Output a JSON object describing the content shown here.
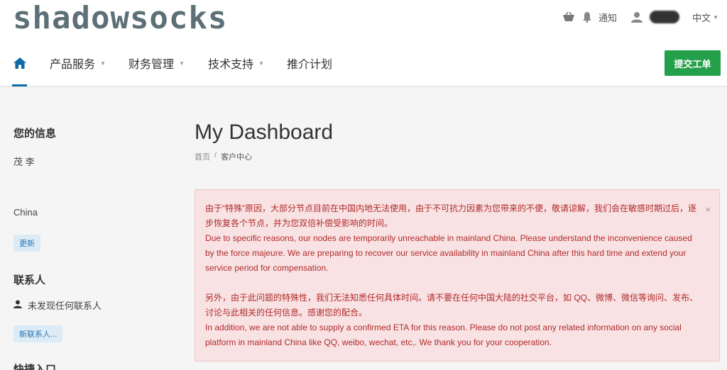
{
  "header": {
    "logo": "shadowsocks",
    "notifications_label": "通知",
    "language": "中文",
    "icons": [
      "basket-icon",
      "bell-icon",
      "user-icon"
    ]
  },
  "nav": {
    "items": [
      {
        "label": "产品服务",
        "has_dropdown": true
      },
      {
        "label": "财务管理",
        "has_dropdown": true
      },
      {
        "label": "技术支持",
        "has_dropdown": true
      },
      {
        "label": "推介计划",
        "has_dropdown": false
      }
    ],
    "submit_ticket": "提交工单"
  },
  "sidebar": {
    "info_heading": "您的信息",
    "name": "茂 李",
    "country": "China",
    "update_button": "更新",
    "contacts_heading": "联系人",
    "no_contacts": "未发现任何联系人",
    "new_contact_button": "新联系人...",
    "shortcuts_heading": "快捷入口"
  },
  "main": {
    "title": "My Dashboard",
    "breadcrumb": {
      "home": "首页",
      "separator": "/",
      "current": "客户中心"
    },
    "alert": {
      "close": "×",
      "p1_zh": "由于“特殊”原因，大部分节点目前在中国内地无法使用，由于不可抗力因素为您带来的不便，敬请谅解，我们会在敏感时期过后，逐步恢复各个节点，并为您双倍补偿受影响的时间。",
      "p1_en": "Due to specific reasons, our nodes are temporarily unreachable in mainland China. Please understand the inconvenience caused by the force majeure. We are preparing to recover our service availability in mainland China after this hard time and extend your service period for compensation.",
      "p2_zh": "另外，由于此问题的特殊性，我们无法知悉任何具体时间。请不要在任何中国大陆的社交平台，如 QQ、微博、微信等询问、发布、讨论与此相关的任何信息。感谢您的配合。",
      "p2_en": "In addition, we are not able to supply a confirmed ETA for this reason. Please do not post any related information on any social platform in mainland China like QQ, weibo, wechat, etc,. We thank you for your cooperation."
    }
  },
  "colors": {
    "accent": "#0e6aa6",
    "success": "#24a04a",
    "alert_bg": "#f8e2e3",
    "alert_text": "#b12b2b"
  }
}
